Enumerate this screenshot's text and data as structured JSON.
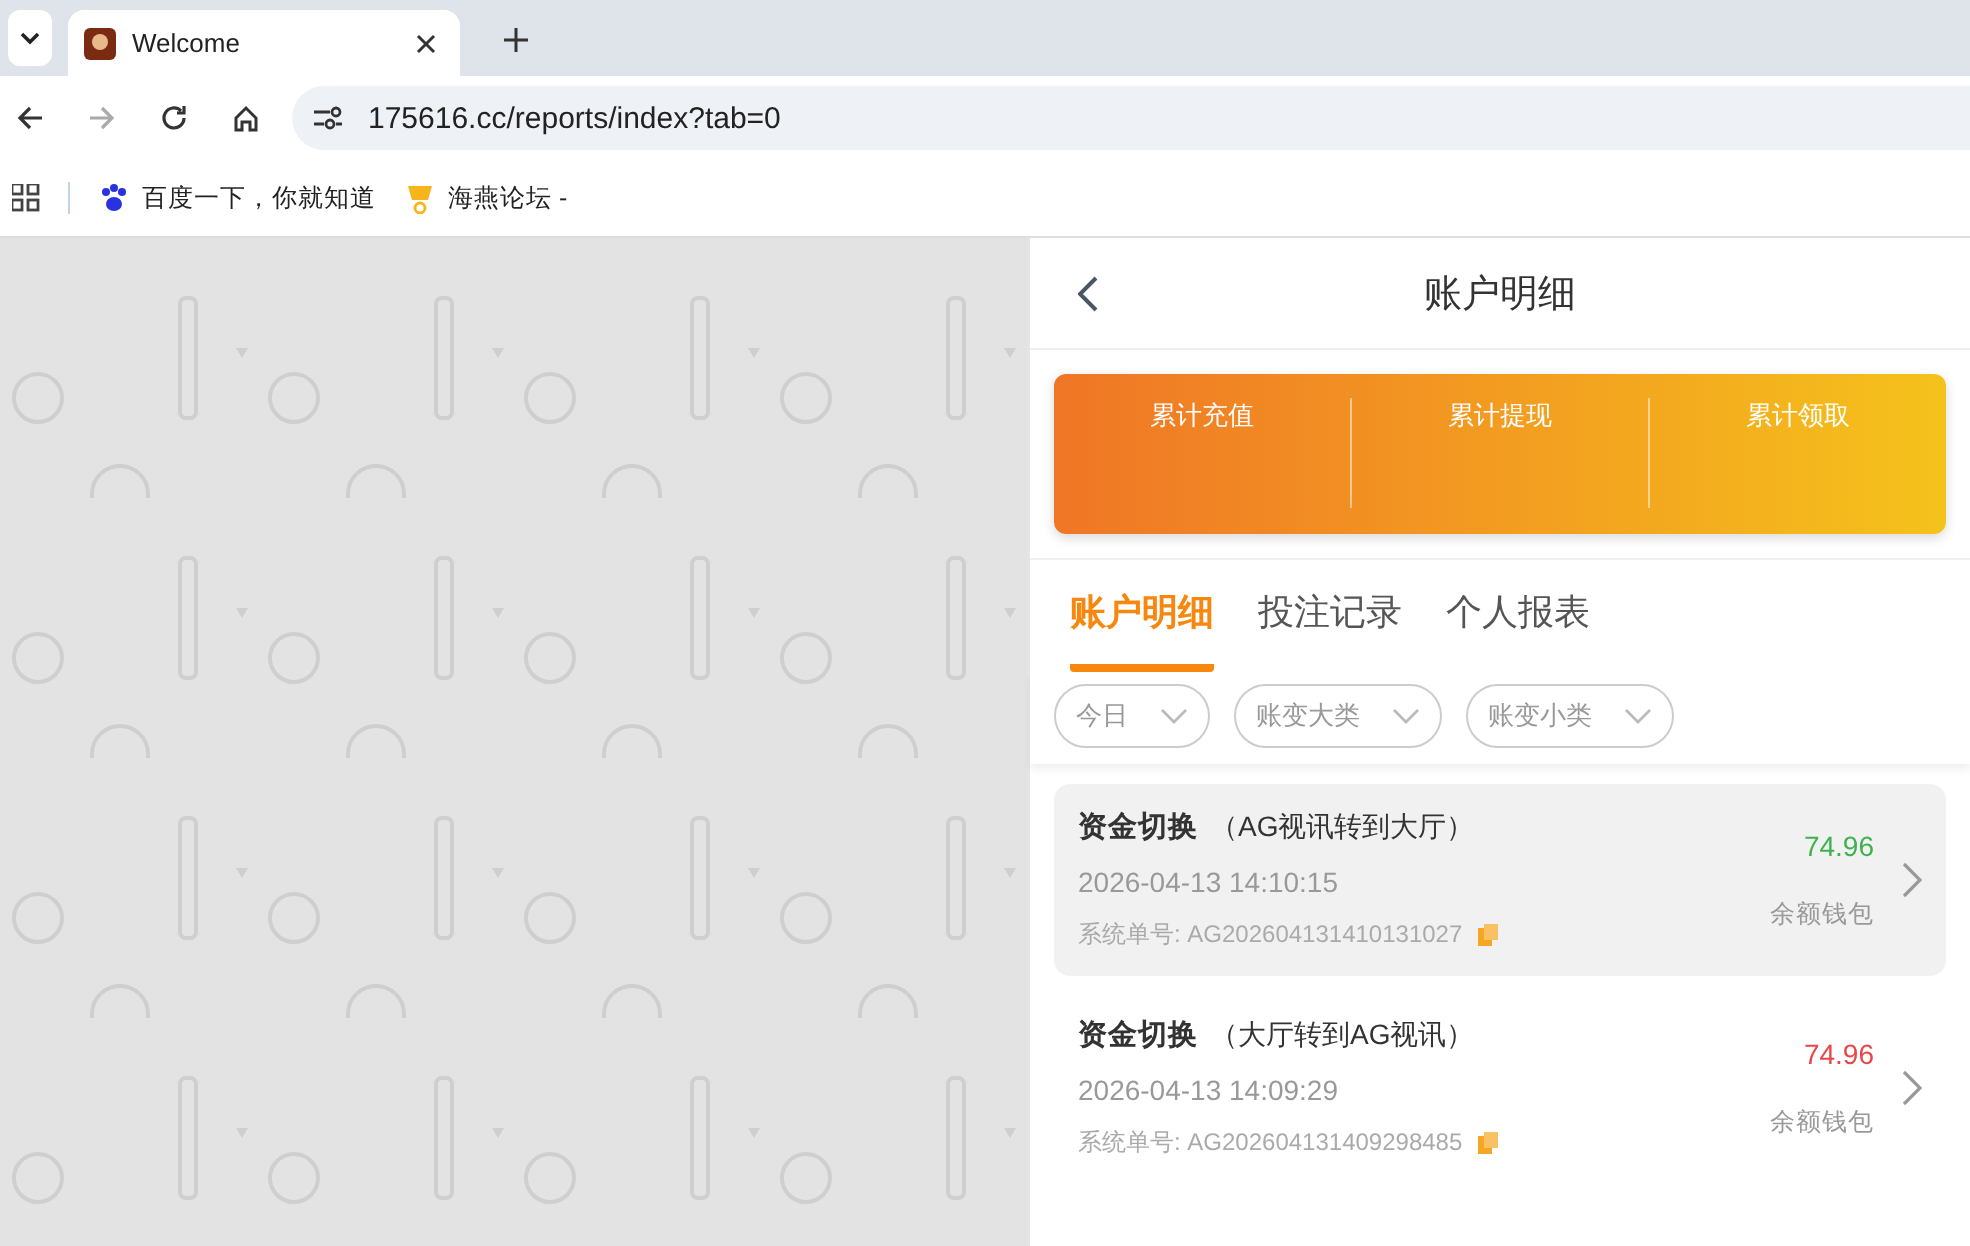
{
  "browser": {
    "tab_title": "Welcome",
    "url": "175616.cc/reports/index?tab=0",
    "bookmarks": [
      {
        "label": "百度一下，你就知道"
      },
      {
        "label": "海燕论坛 -"
      }
    ]
  },
  "header": {
    "title": "账户明细"
  },
  "summary": [
    {
      "label": "累计充值"
    },
    {
      "label": "累计提现"
    },
    {
      "label": "累计领取"
    }
  ],
  "tabs": [
    {
      "label": "账户明细",
      "selected": true
    },
    {
      "label": "投注记录",
      "selected": false
    },
    {
      "label": "个人报表",
      "selected": false
    }
  ],
  "filters": [
    {
      "label": "今日"
    },
    {
      "label": "账变大类"
    },
    {
      "label": "账变小类"
    }
  ],
  "records": [
    {
      "title": "资金切换",
      "detail": "（AG视讯转到大厅）",
      "time": "2026-04-13 14:10:15",
      "order_label": "系统单号:",
      "order_no": "AG202604131410131027",
      "amount": "74.96",
      "kind": "credit",
      "wallet": "余额钱包",
      "selected": true
    },
    {
      "title": "资金切换",
      "detail": "（大厅转到AG视讯）",
      "time": "2026-04-13 14:09:29",
      "order_label": "系统单号:",
      "order_no": "AG202604131409298485",
      "amount": "74.96",
      "kind": "debit",
      "wallet": "余额钱包",
      "selected": false
    }
  ]
}
